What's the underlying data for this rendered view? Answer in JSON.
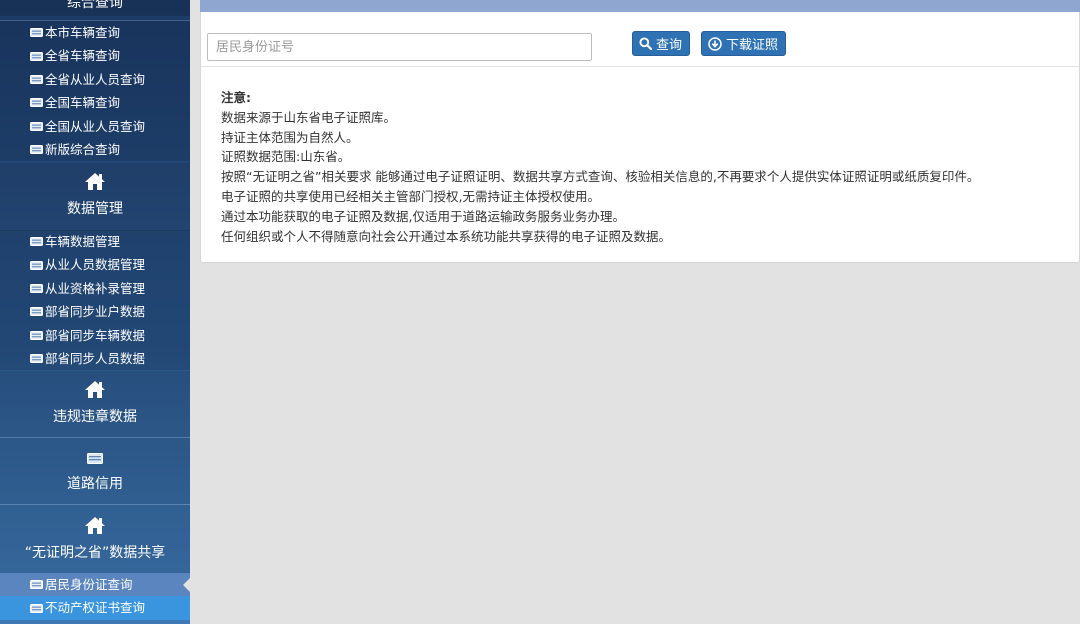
{
  "sidebar": {
    "top_title": "综合查询",
    "group1": [
      {
        "label": "本市车辆查询"
      },
      {
        "label": "全省车辆查询"
      },
      {
        "label": "全省从业人员查询"
      },
      {
        "label": "全国车辆查询"
      },
      {
        "label": "全国从业人员查询"
      },
      {
        "label": "新版综合查询"
      }
    ],
    "sections": {
      "data_mgmt": {
        "title": "数据管理",
        "icon": "home-icon"
      },
      "violation": {
        "title": "违规违章数据",
        "icon": "home-icon"
      },
      "road_credit": {
        "title": "道路信用",
        "icon": "card-icon"
      },
      "share": {
        "title": "“无证明之省”数据共享",
        "icon": "home-icon"
      }
    },
    "group2": [
      {
        "label": "车辆数据管理"
      },
      {
        "label": "从业人员数据管理"
      },
      {
        "label": "从业资格补录管理"
      },
      {
        "label": "部省同步业户数据"
      },
      {
        "label": "部省同步车辆数据"
      },
      {
        "label": "部省同步人员数据"
      }
    ],
    "group3": [
      {
        "label": "居民身份证查询",
        "active": true
      },
      {
        "label": "不动产权证书查询"
      }
    ]
  },
  "search": {
    "placeholder": "居民身份证号",
    "value": ""
  },
  "buttons": {
    "query": "查询",
    "download": "下载证照"
  },
  "notice": {
    "title": "注意:",
    "lines": [
      "数据来源于山东省电子证照库。",
      "持证主体范围为自然人。",
      "证照数据范围:山东省。",
      "按照“无证明之省”相关要求 能够通过电子证照证明、数据共享方式查询、核验相关信息的,不再要求个人提供实体证照证明或纸质复印件。",
      "电子证照的共享使用已经相关主管部门授权,无需持证主体授权使用。",
      "通过本功能获取的电子证照及数据,仅适用于道路运输政务服务业务办理。",
      "任何组织或个人不得随意向社会公开通过本系统功能共享获得的电子证照及数据。"
    ]
  },
  "colors": {
    "sidebar_top": "#1d3a66",
    "sidebar_bottom": "#3f79b5",
    "button": "#2f72b4",
    "active_item": "#5a85bf",
    "topbar": "#8fa6d0",
    "background": "#e2e2e2"
  }
}
